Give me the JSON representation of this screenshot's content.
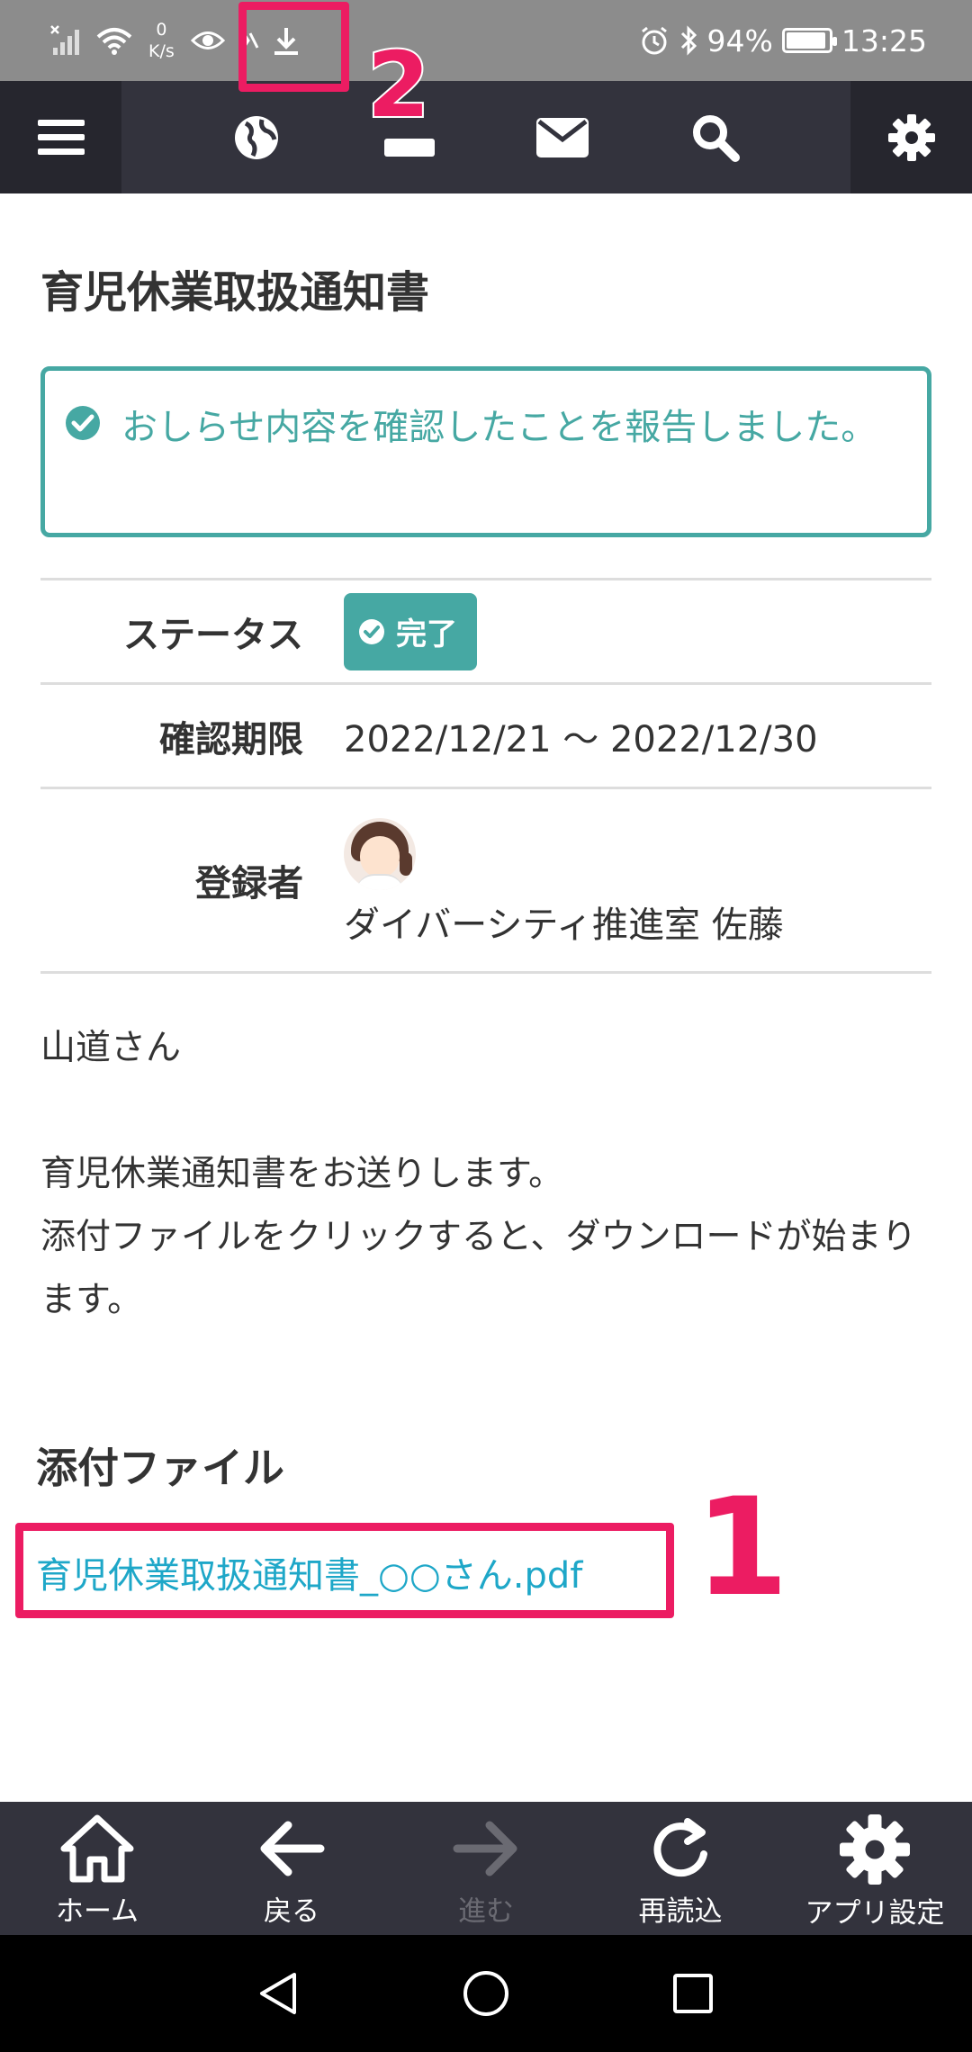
{
  "status_bar": {
    "network_speed_value": "0",
    "network_speed_unit": "K/s",
    "battery": "94%",
    "time": "13:25",
    "battery_level": 0.94
  },
  "page": {
    "title": "育児休業取扱通知書",
    "notice": "おしらせ内容を確認したことを報告しました。"
  },
  "info": {
    "status_label": "ステータス",
    "status_value": "完了",
    "deadline_label": "確認期限",
    "deadline_value": "2022/12/21 〜 2022/12/30",
    "registrant_label": "登録者",
    "registrant_name": "ダイバーシティ推進室 佐藤"
  },
  "message": {
    "greeting": "山道さん",
    "line1": "育児休業通知書をお送りします。",
    "line2": "添付ファイルをクリックすると、ダウンロードが始まります。"
  },
  "attachments": {
    "title": "添付ファイル",
    "file_name": "育児休業取扱通知書_○○さん.pdf"
  },
  "annotations": {
    "step1": "1",
    "step2": "2",
    "color": "#ec1c62"
  },
  "bottom_bar": {
    "home": "ホーム",
    "back": "戻る",
    "forward": "進む",
    "reload": "再読込",
    "app_settings": "アプリ設定"
  },
  "colors": {
    "accent": "#46a8a3",
    "link": "#1ea7c8",
    "nav_bg": "#33333d"
  }
}
